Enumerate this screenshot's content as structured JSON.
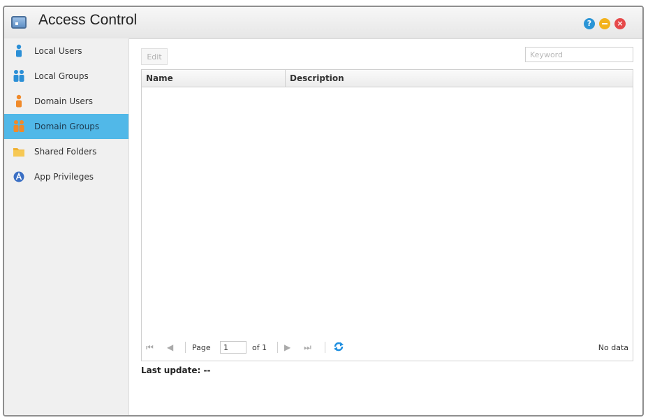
{
  "window": {
    "title": "Access Control"
  },
  "sidebar": {
    "items": [
      {
        "label": "Local Users",
        "icon": "user-icon",
        "color": "#2b8fd6",
        "active": false
      },
      {
        "label": "Local Groups",
        "icon": "users-icon",
        "color": "#2b8fd6",
        "active": false
      },
      {
        "label": "Domain Users",
        "icon": "user-icon",
        "color": "#f08a2a",
        "active": false
      },
      {
        "label": "Domain Groups",
        "icon": "users-icon",
        "color": "#f08a2a",
        "active": true
      },
      {
        "label": "Shared Folders",
        "icon": "folder-icon",
        "color": "#f0b030",
        "active": false
      },
      {
        "label": "App Privileges",
        "icon": "app-icon",
        "color": "#3a6fc4",
        "active": false
      }
    ]
  },
  "toolbar": {
    "edit_label": "Edit",
    "search_placeholder": "Keyword"
  },
  "grid": {
    "columns": [
      "Name",
      "Description"
    ],
    "rows": []
  },
  "pager": {
    "page_label": "Page",
    "page_value": "1",
    "of_label": "of 1",
    "status": "No data"
  },
  "footer": {
    "last_update": "Last update: --"
  },
  "colors": {
    "accent": "#51b8e8",
    "help": "#2b95d6",
    "minimize": "#f3b21c",
    "close": "#e6494a"
  }
}
